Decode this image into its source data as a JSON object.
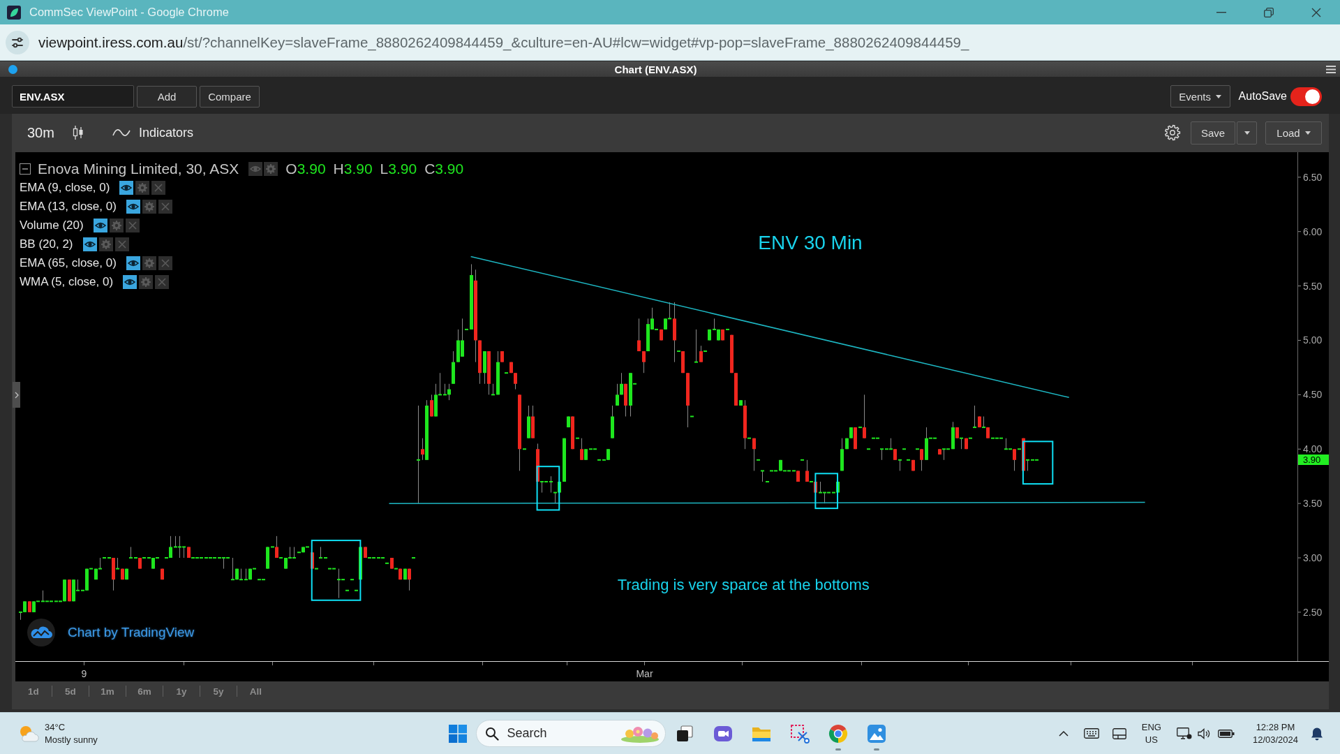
{
  "window": {
    "title": "CommSec ViewPoint - Google Chrome"
  },
  "address_bar": {
    "host": "viewpoint.iress.com.au",
    "path": "/st/?channelKey=slaveFrame_8880262409844459_&culture=en-AU#lcw=widget#vp-pop=slaveFrame_8880262409844459_"
  },
  "panel": {
    "title": "Chart (ENV.ASX)"
  },
  "toolbar": {
    "symbol": "ENV.ASX",
    "buttons": [
      "Add",
      "Compare"
    ],
    "events": "Events",
    "autosave": {
      "label": "AutoSave",
      "on": true
    }
  },
  "chart_toolbar": {
    "interval": "30m",
    "indicators": "Indicators",
    "save": "Save",
    "load": "Load"
  },
  "legend": {
    "title": "Enova Mining Limited, 30, ASX",
    "ohlc": [
      {
        "label": "O",
        "value": "3.90"
      },
      {
        "label": "H",
        "value": "3.90"
      },
      {
        "label": "L",
        "value": "3.90"
      },
      {
        "label": "C",
        "value": "3.90"
      }
    ],
    "indicators": [
      {
        "name": "EMA (9, close, 0)",
        "visible": true
      },
      {
        "name": "EMA (13, close, 0)",
        "visible": true
      },
      {
        "name": "Volume (20)",
        "visible": true
      },
      {
        "name": "BB (20, 2)",
        "visible": true
      },
      {
        "name": "EMA (65, close, 0)",
        "visible": true
      },
      {
        "name": "WMA (5, close, 0)",
        "visible": true
      }
    ]
  },
  "chart": {
    "title": "ENV 30 Min",
    "note": "Trading is very sparce at the bottoms",
    "attribution": "Chart by TradingView",
    "price_labels": [
      "6.50",
      "6.00",
      "5.50",
      "5.00",
      "4.50",
      "4.00",
      "3.50",
      "3.00",
      "2.50"
    ],
    "last_price": "3.90",
    "time_labels": [
      "9",
      "Mar"
    ]
  },
  "ranges": [
    "1d",
    "5d",
    "1m",
    "6m",
    "1y",
    "5y",
    "All"
  ],
  "taskbar": {
    "weather": {
      "temperature": "34°C",
      "condition": "Mostly sunny"
    },
    "search": {
      "placeholder": "Search"
    },
    "apps": [
      {
        "kind": "taskview",
        "running": false
      },
      {
        "kind": "chat",
        "running": false
      },
      {
        "kind": "explorer",
        "running": false
      },
      {
        "kind": "snipping",
        "running": false
      },
      {
        "kind": "browser",
        "running": true
      },
      {
        "kind": "photos",
        "running": true
      }
    ],
    "language": {
      "code": "ENG",
      "region": "US"
    },
    "clock": {
      "time": "12:28 PM",
      "date": "12/03/2024"
    }
  }
}
